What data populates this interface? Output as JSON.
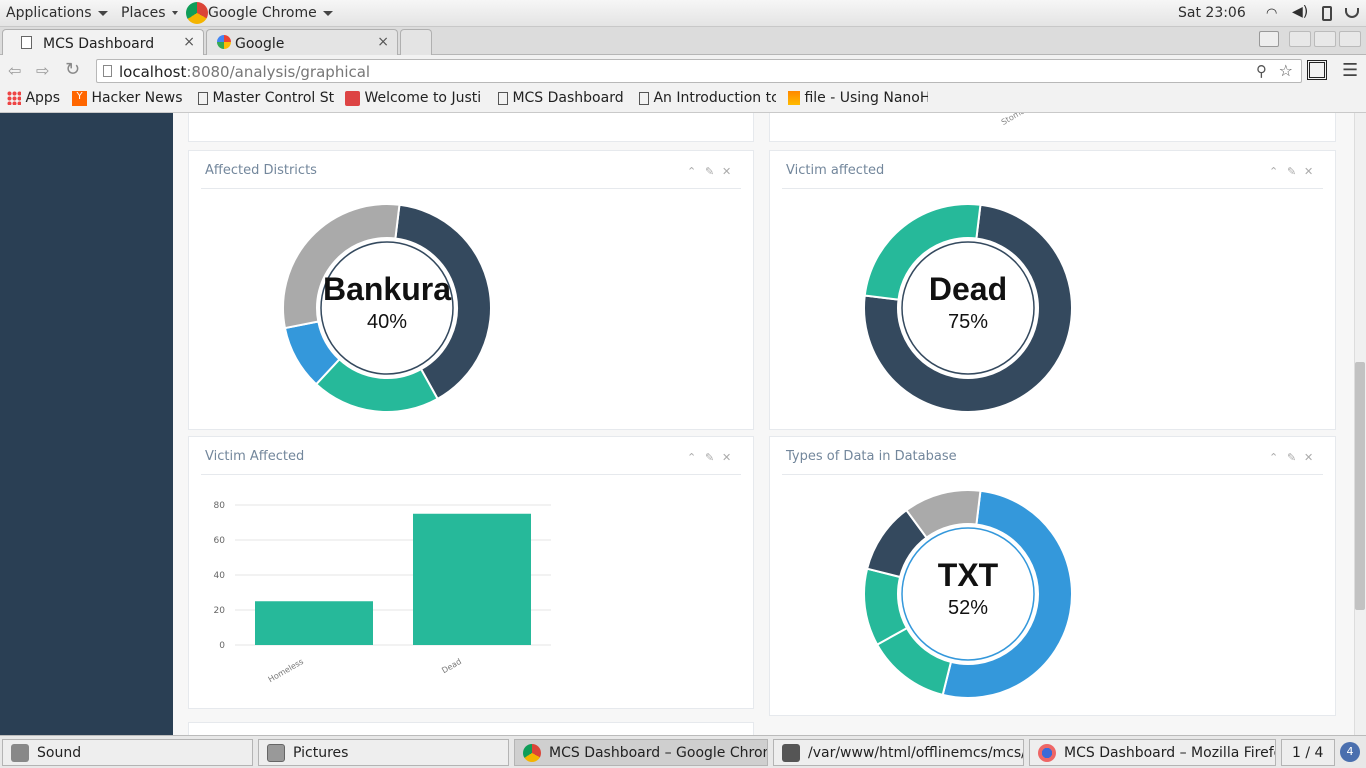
{
  "topbar": {
    "applications": "Applications",
    "places": "Places",
    "active_app": "Google Chrome",
    "clock": "Sat 23:06"
  },
  "tabs": [
    {
      "label": "MCS Dashboard",
      "close": "×"
    },
    {
      "label": "Google",
      "close": "×"
    }
  ],
  "omnibox": {
    "host": "localhost",
    "path": ":8080/analysis/graphical"
  },
  "bookmarks": [
    {
      "label": "Apps"
    },
    {
      "label": "Hacker News"
    },
    {
      "label": "Master Control St"
    },
    {
      "label": "Welcome to Justi"
    },
    {
      "label": "MCS Dashboard"
    },
    {
      "label": "An Introduction tc"
    },
    {
      "label": "file - Using NanoH"
    }
  ],
  "top_partial_labels": {
    "right": "Stomac"
  },
  "panels": {
    "affected_districts": {
      "title": "Affected Districts",
      "center_label": "Bankura",
      "center_value": "40%"
    },
    "victim_affected_donut": {
      "title": "Victim affected",
      "center_label": "Dead",
      "center_value": "75%"
    },
    "victim_affected_bar": {
      "title": "Victim Affected"
    },
    "types_of_data": {
      "title": "Types of Data in Database",
      "center_label": "TXT",
      "center_value": "52%"
    }
  },
  "chart_data": [
    {
      "type": "pie",
      "title": "Affected Districts",
      "values": [
        40,
        20,
        10,
        30
      ],
      "colors": [
        "#34495e",
        "#26b99a",
        "#3498db",
        "#aaaaaa"
      ],
      "highlight": {
        "label": "Bankura",
        "value": "40%"
      }
    },
    {
      "type": "pie",
      "title": "Victim affected",
      "values": [
        75,
        25
      ],
      "colors": [
        "#34495e",
        "#26b99a"
      ],
      "highlight": {
        "label": "Dead",
        "value": "75%"
      }
    },
    {
      "type": "bar",
      "title": "Victim Affected",
      "categories": [
        "Homeless",
        "Dead"
      ],
      "values": [
        25,
        75
      ],
      "yticks": [
        "0",
        "20",
        "40",
        "60",
        "80"
      ],
      "ylim": [
        0,
        80
      ],
      "color": "#26b99a"
    },
    {
      "type": "pie",
      "title": "Types of Data in Database",
      "values": [
        52,
        13,
        12,
        11,
        12
      ],
      "colors": [
        "#3498db",
        "#26b99a",
        "#26b99a",
        "#34495e",
        "#aaaaaa"
      ],
      "highlight": {
        "label": "TXT",
        "value": "52%"
      }
    }
  ],
  "taskbar": {
    "items": [
      {
        "label": "Sound"
      },
      {
        "label": "Pictures"
      },
      {
        "label": "MCS Dashboard – Google Chrome"
      },
      {
        "label": "/var/www/html/offlinemcs/mcs/..."
      },
      {
        "label": "MCS Dashboard – Mozilla Firefox"
      }
    ],
    "workspace": "1 / 4",
    "notifications": "4"
  }
}
